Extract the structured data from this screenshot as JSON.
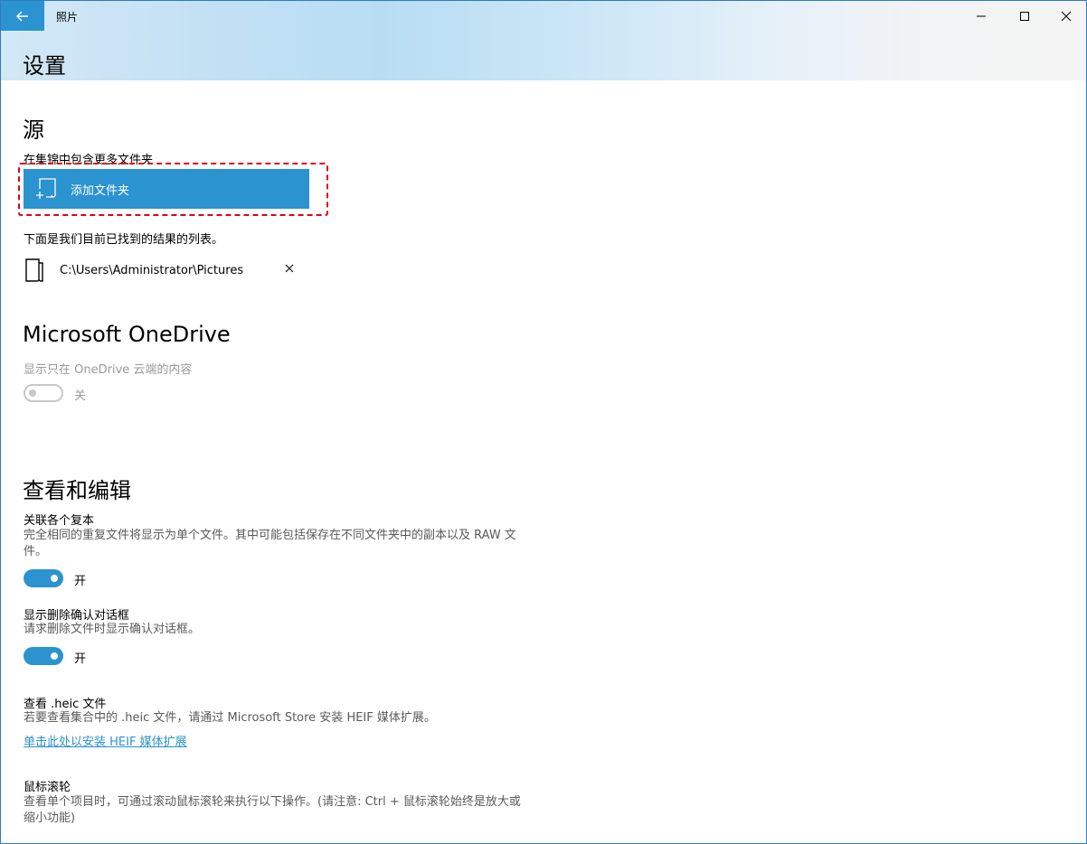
{
  "titlebar": {
    "app_name": "照片"
  },
  "page": {
    "title": "设置"
  },
  "sources": {
    "title": "源",
    "include_label": "在集锦中包含更多文件夹",
    "add_folder_label": "添加文件夹",
    "results_label": "下面是我们目前已找到的结果的列表。",
    "folders": [
      "C:\\Users\\Administrator\\Pictures"
    ]
  },
  "onedrive": {
    "title": "Microsoft OneDrive",
    "desc": "显示只在 OneDrive 云端的内容",
    "state": "关"
  },
  "view_edit": {
    "title": "查看和编辑",
    "linked_title": "关联各个复本",
    "linked_desc": "完全相同的重复文件将显示为单个文件。其中可能包括保存在不同文件夹中的副本以及 RAW 文件。",
    "linked_state": "开",
    "delete_title": "显示删除确认对话框",
    "delete_desc": "请求删除文件时显示确认对话框。",
    "delete_state": "开",
    "heic_title": "查看 .heic 文件",
    "heic_desc": "若要查看集合中的 .heic 文件，请通过 Microsoft Store 安装 HEIF 媒体扩展。",
    "heic_link": "单击此处以安装 HEIF 媒体扩展",
    "wheel_title": "鼠标滚轮",
    "wheel_desc": "查看单个项目时，可通过滚动鼠标滚轮来执行以下操作。(请注意: Ctrl + 鼠标滚轮始终是放大或缩小功能)"
  },
  "colors": {
    "accent": "#2b93cf",
    "highlight": "#e0001a"
  }
}
